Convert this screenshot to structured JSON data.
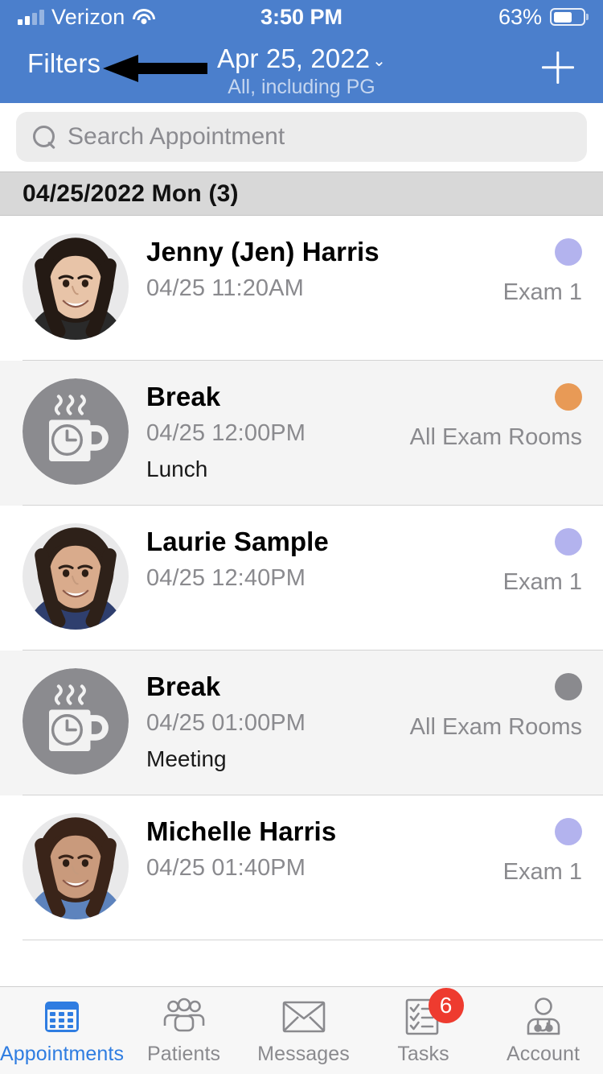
{
  "status_bar": {
    "carrier": "Verizon",
    "time": "3:50 PM",
    "battery_pct": "63%",
    "battery_level": 63,
    "wifi_icon": "wifi-icon",
    "signal_icon": "signal-bars-icon"
  },
  "nav": {
    "filters_label": "Filters",
    "title": "Apr 25, 2022",
    "chevron": "⌄",
    "subtitle": "All, including PG",
    "add_label": "+"
  },
  "annotation": {
    "arrow": "left-pointing-arrow"
  },
  "search": {
    "placeholder": "Search Appointment",
    "value": "",
    "icon": "search-icon"
  },
  "section": {
    "header": "04/25/2022 Mon (3)"
  },
  "colors": {
    "header_blue": "#4b7fcc",
    "accent_blue": "#2f7de1",
    "dot_purple": "#b3b3ee",
    "dot_orange": "#e89a56",
    "dot_gray": "#8a8a8e",
    "badge_red": "#ee3b2f",
    "section_gray": "#d8d8d8",
    "row_alt": "#f4f4f4"
  },
  "appointments": [
    {
      "name": "Jenny (Jen) Harris",
      "time": "04/25 11:20AM",
      "note": "",
      "room": "Exam 1",
      "dot_color": "#b3b3ee",
      "avatar_type": "photo",
      "avatar_name": "patient-photo"
    },
    {
      "name": "Break",
      "time": "04/25 12:00PM",
      "note": "Lunch",
      "room": "All Exam Rooms",
      "dot_color": "#e89a56",
      "avatar_type": "break",
      "avatar_name": "coffee-break-icon"
    },
    {
      "name": "Laurie Sample",
      "time": "04/25 12:40PM",
      "note": "",
      "room": "Exam 1",
      "dot_color": "#b3b3ee",
      "avatar_type": "photo",
      "avatar_name": "patient-photo"
    },
    {
      "name": "Break",
      "time": "04/25 01:00PM",
      "note": "Meeting",
      "room": "All Exam Rooms",
      "dot_color": "#8a8a8e",
      "avatar_type": "break",
      "avatar_name": "coffee-break-icon"
    },
    {
      "name": "Michelle Harris",
      "time": "04/25 01:40PM",
      "note": "",
      "room": "Exam 1",
      "dot_color": "#b3b3ee",
      "avatar_type": "photo",
      "avatar_name": "patient-photo"
    }
  ],
  "tabs": [
    {
      "label": "Appointments",
      "icon": "calendar-icon",
      "active": true,
      "badge": ""
    },
    {
      "label": "Patients",
      "icon": "people-group-icon",
      "active": false,
      "badge": ""
    },
    {
      "label": "Messages",
      "icon": "envelope-icon",
      "active": false,
      "badge": ""
    },
    {
      "label": "Tasks",
      "icon": "checklist-icon",
      "active": false,
      "badge": "6"
    },
    {
      "label": "Account",
      "icon": "doctor-stethoscope-icon",
      "active": false,
      "badge": ""
    }
  ]
}
